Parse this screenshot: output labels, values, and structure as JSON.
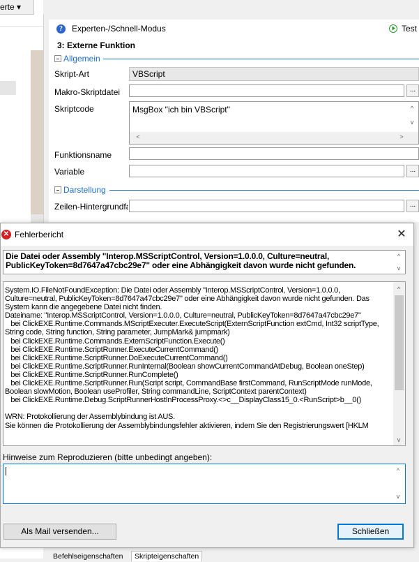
{
  "background": {
    "left_tab_label": "erte ▾",
    "mode_label": "Experten-/Schnell-Modus",
    "test_label": "Test",
    "section_title": "3: Externe Funktion",
    "group_general": "Allgemein",
    "group_display": "Darstellung",
    "fields": {
      "script_type_label": "Skript-Art",
      "script_type_value": "VBScript",
      "macro_file_label": "Makro-Skriptdatei",
      "macro_file_value": "",
      "script_code_label": "Skriptcode",
      "script_code_value": "MsgBox \"ich bin VBScript\"",
      "function_name_label": "Funktionsname",
      "function_name_value": "",
      "variable_label": "Variable",
      "variable_value": "",
      "row_bg_label": "Zeilen-Hintergrundfarl",
      "row_bg_value": ""
    },
    "ellipsis": "...",
    "bottom_tabs": [
      "Befehlseigenschaften",
      "Skripteigenschaften"
    ]
  },
  "dialog": {
    "title": "Fehlerbericht",
    "summary": "Die Datei oder Assembly \"Interop.MSScriptControl, Version=1.0.0.0, Culture=neutral, PublicKeyToken=8d7647a47cbc29e7\" oder eine Abhängigkeit davon wurde nicht gefunden.",
    "details": "System.IO.FileNotFoundException: Die Datei oder Assembly \"Interop.MSScriptControl, Version=1.0.0.0, Culture=neutral, PublicKeyToken=8d7647a47cbc29e7\" oder eine Abhängigkeit davon wurde nicht gefunden. Das System kann die angegebene Datei nicht finden.\nDateiname: \"Interop.MSScriptControl, Version=1.0.0.0, Culture=neutral, PublicKeyToken=8d7647a47cbc29e7\"\n   bei ClickEXE.Runtime.Commands.MScriptExecuter.ExecuteScript(ExternScriptFunction extCmd, Int32 scriptType, String code, String function, String parameter, JumpMark& jumpmark)\n   bei ClickEXE.Runtime.Commands.ExternScriptFunction.Execute()\n   bei ClickEXE.Runtime.ScriptRunner.ExecuteCurrentCommand()\n   bei ClickEXE.Runtime.ScriptRunner.DoExecuteCurrentCommand()\n   bei ClickEXE.Runtime.ScriptRunner.RunInternal(Boolean showCurrentCommandAtDebug, Boolean oneStep)\n   bei ClickEXE.Runtime.ScriptRunner.RunComplete()\n   bei ClickEXE.Runtime.ScriptRunner.Run(Script script, CommandBase firstCommand, RunScriptMode runMode, Boolean slowMotion, Boolean useProfiler, String commandLine, ScriptContext parentContext)\n   bei ClickEXE.Runtime.Debug.ScriptRunnerHostInProcessProxy.<>c__DisplayClass15_0.<RunScript>b__0()\n\nWRN: Protokollierung der Assemblybindung ist AUS.\nSie können die Protokollierung der Assemblybindungsfehler aktivieren, indem Sie den Registrierungswert [HKLM",
    "repro_label": "Hinweise zum Reproduzieren (bitte unbedingt angeben):",
    "repro_value": "",
    "mail_button": "Als Mail versenden...",
    "close_button": "Schließen",
    "close_glyph": "✕"
  },
  "icons": {
    "info": "info-icon",
    "play": "play-icon",
    "error": "error-icon",
    "collapse": "minus-box-icon",
    "scroll_up": "chevron-up-icon",
    "scroll_down": "chevron-down-icon",
    "scroll_left": "chevron-left-icon",
    "scroll_right": "chevron-right-icon"
  },
  "colors": {
    "accent_blue": "#1e6ec8",
    "error_red": "#d42020",
    "default_button_border": "#0078d7"
  }
}
